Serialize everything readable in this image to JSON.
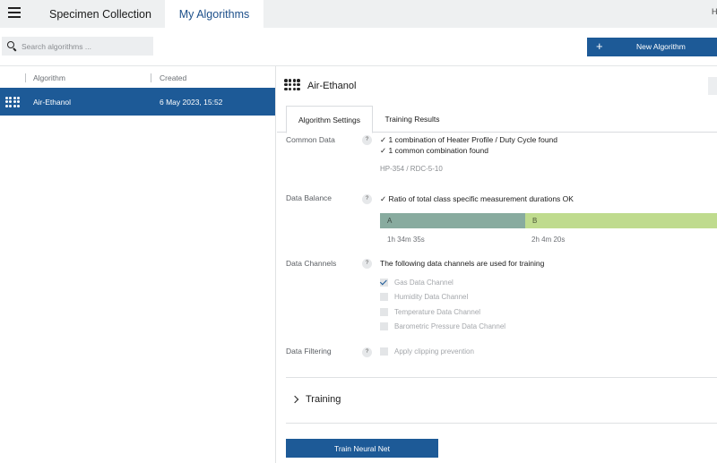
{
  "topbar": {
    "menu_icon": "hamburger-icon",
    "tabs": [
      {
        "label": "Specimen Collection"
      },
      {
        "label": "My Algorithms"
      }
    ],
    "right_char": "H"
  },
  "search": {
    "placeholder": "Search algorithms ..."
  },
  "toolbar": {
    "new_label": "New Algorithm",
    "new_icon": "plus-icon"
  },
  "list": {
    "columns": [
      "Algorithm",
      "Created"
    ],
    "rows": [
      {
        "name": "Air-Ethanol",
        "created": "6 May 2023, 15:52",
        "icon": "algorithm-dots-icon"
      }
    ]
  },
  "detail": {
    "title": "Air-Ethanol",
    "subtabs": [
      "Algorithm Settings",
      "Training Results"
    ],
    "common_data": {
      "label": "Common Data",
      "lines": [
        "✓ 1 combination of Heater Profile / Duty Cycle found",
        "✓ 1 common combination found"
      ],
      "profile": "HP-354 / RDC-5-10"
    },
    "data_balance": {
      "label": "Data Balance",
      "line": "✓ Ratio of total class specific measurement durations OK",
      "classes": [
        {
          "name": "A",
          "duration": "1h 34m 35s",
          "color": "#88ab9f"
        },
        {
          "name": "B",
          "duration": "2h 4m 20s",
          "color": "#bfdb8e"
        }
      ]
    },
    "data_channels": {
      "label": "Data Channels",
      "intro": "The following data channels are used for training",
      "channels": [
        {
          "label": "Gas Data Channel",
          "checked": true
        },
        {
          "label": "Humidity Data Channel",
          "checked": false
        },
        {
          "label": "Temperature Data Channel",
          "checked": false
        },
        {
          "label": "Barometric Pressure Data Channel",
          "checked": false
        }
      ]
    },
    "data_filtering": {
      "label": "Data Filtering",
      "option": "Apply clipping prevention",
      "checked": false
    },
    "help_glyph": "?",
    "training_label": "Training",
    "train_button": "Train Neural Net"
  },
  "colors": {
    "accent": "#1d5a97",
    "topbar_bg": "#eef0f1"
  }
}
